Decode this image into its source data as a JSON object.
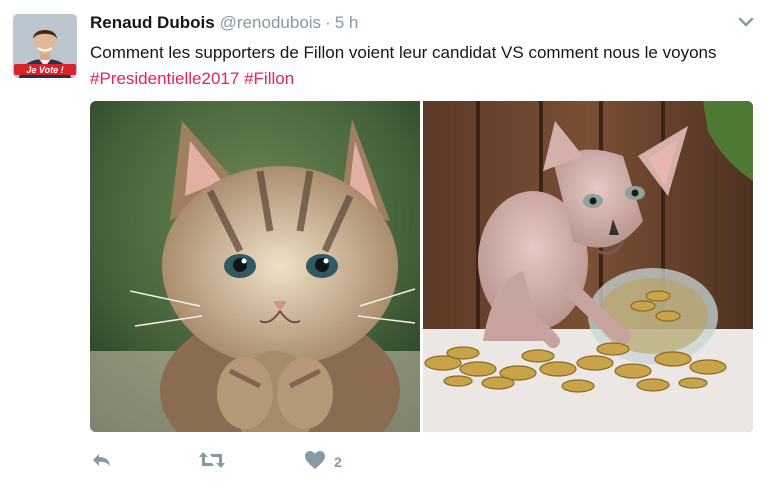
{
  "author": {
    "name": "Renaud Dubois",
    "handle": "@renodubois",
    "separator": "·",
    "time": "5 h",
    "avatar_badge": "Je Vote !"
  },
  "tweet": {
    "text_before": "Comment les supporters de Fillon voient leur candidat VS comment nous le voyons ",
    "hashtags": [
      "#Presidentielle2017",
      "#Fillon"
    ]
  },
  "media": [
    {
      "kind": "photo",
      "subject": "kitten-praying"
    },
    {
      "kind": "photo",
      "subject": "sphynx-cat-with-coins"
    }
  ],
  "actions": {
    "reply_icon": "reply-icon",
    "retweet_icon": "retweet-icon",
    "like_icon": "heart-icon",
    "like_count": "2"
  },
  "colors": {
    "hashtag": "#e0245e",
    "muted": "#8899a6",
    "text": "#14171a",
    "badge": "#d8232a"
  }
}
